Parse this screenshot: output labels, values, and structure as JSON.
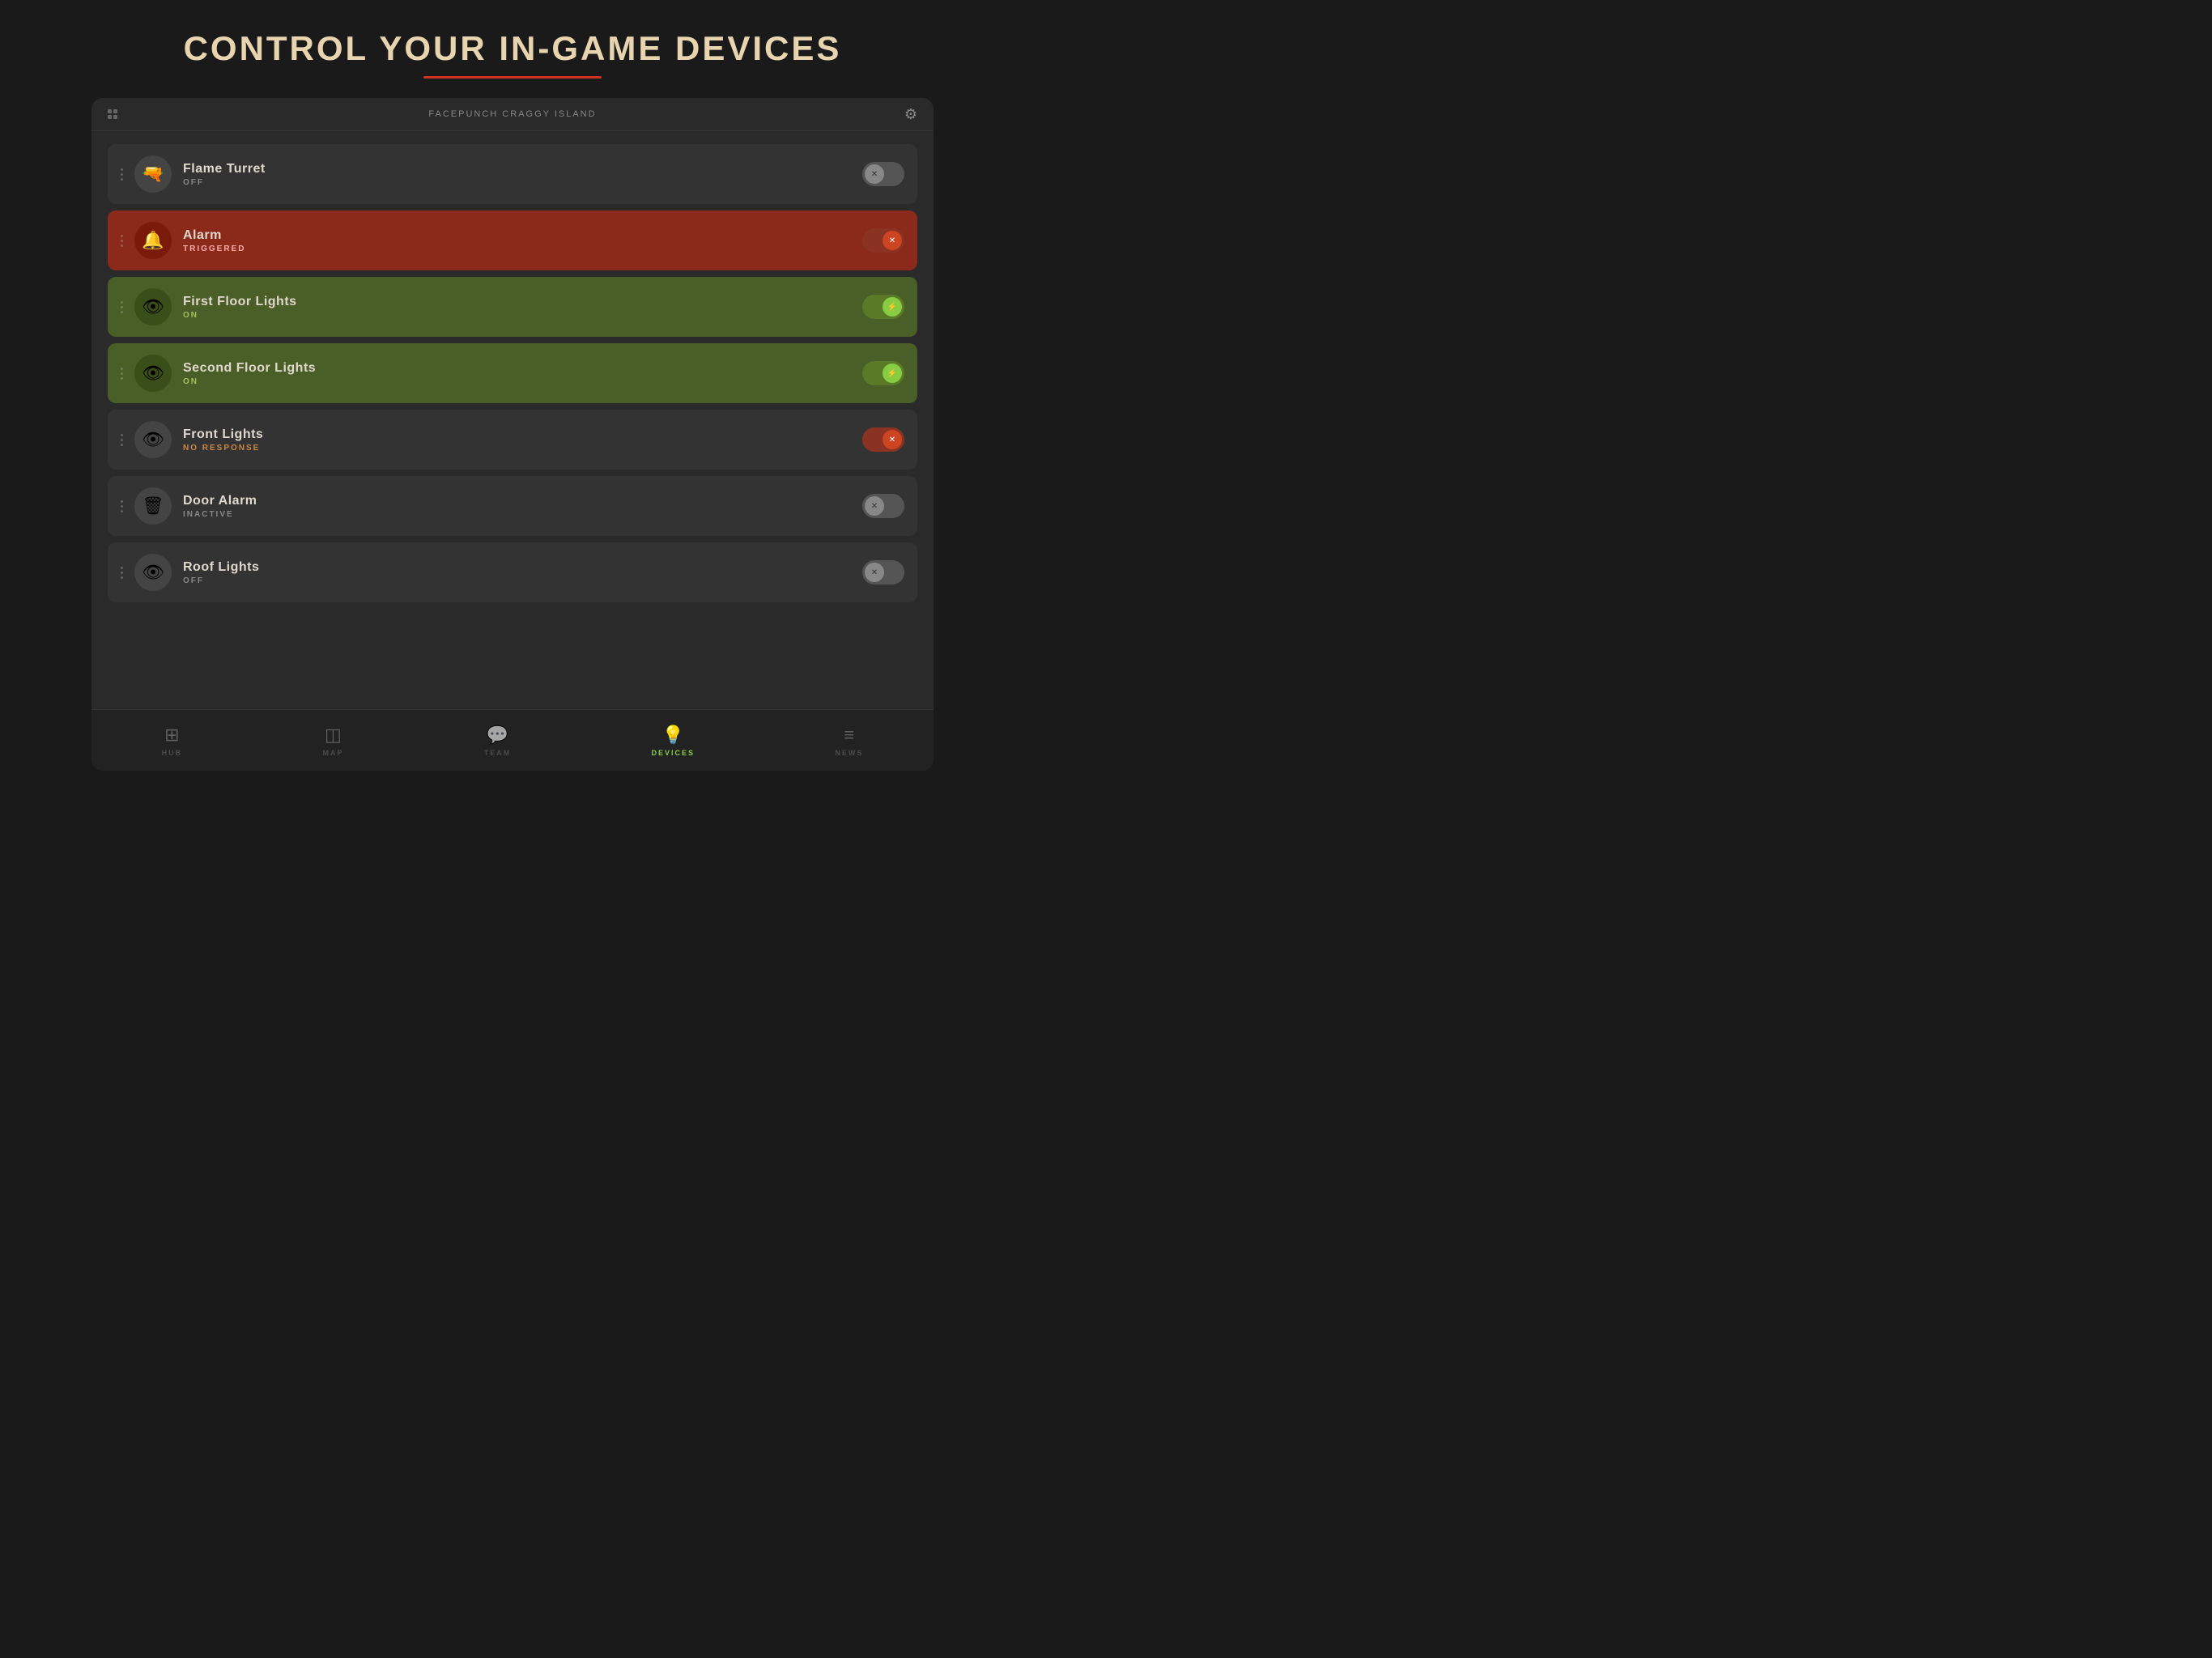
{
  "page": {
    "title": "CONTROL YOUR IN-GAME DEVICES",
    "title_underline_color": "#cc3322"
  },
  "panel": {
    "server_name": "FACEPUNCH CRAGGY ISLAND"
  },
  "devices": [
    {
      "id": "flame-turret",
      "name": "Flame Turret",
      "status": "OFF",
      "status_key": "off",
      "toggle_state": "off",
      "icon": "🔫"
    },
    {
      "id": "alarm",
      "name": "Alarm",
      "status": "TRIGGERED",
      "status_key": "triggered",
      "toggle_state": "error",
      "icon": "🔔"
    },
    {
      "id": "first-floor-lights",
      "name": "First Floor Lights",
      "status": "ON",
      "status_key": "on",
      "toggle_state": "on",
      "icon": "💡"
    },
    {
      "id": "second-floor-lights",
      "name": "Second Floor Lights",
      "status": "ON",
      "status_key": "on",
      "toggle_state": "on",
      "icon": "💡"
    },
    {
      "id": "front-lights",
      "name": "Front Lights",
      "status": "NO RESPONSE",
      "status_key": "no-response",
      "toggle_state": "error",
      "icon": "💡"
    },
    {
      "id": "door-alarm",
      "name": "Door Alarm",
      "status": "INACTIVE",
      "status_key": "inactive",
      "toggle_state": "off",
      "icon": "🚪"
    },
    {
      "id": "roof-lights",
      "name": "Roof Lights",
      "status": "OFF",
      "status_key": "off",
      "toggle_state": "off",
      "icon": "💡"
    }
  ],
  "nav": {
    "items": [
      {
        "id": "hub",
        "label": "HUB",
        "icon": "⊞",
        "active": false
      },
      {
        "id": "map",
        "label": "MAP",
        "icon": "◫",
        "active": false
      },
      {
        "id": "team",
        "label": "TEAM",
        "icon": "💬",
        "active": false
      },
      {
        "id": "devices",
        "label": "DEVICES",
        "icon": "💡",
        "active": true
      },
      {
        "id": "news",
        "label": "NEWS",
        "icon": "≡",
        "active": false
      }
    ]
  }
}
